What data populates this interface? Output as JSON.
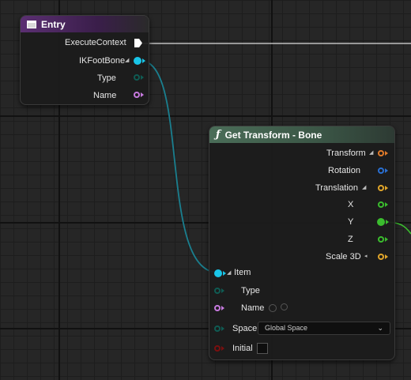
{
  "entry_node": {
    "title": "Entry",
    "pins": [
      {
        "label": "ExecuteContext",
        "kind": "exec",
        "color": "#ffffff"
      },
      {
        "label": "IKFootBone",
        "kind": "struct",
        "color": "#19c5e8"
      },
      {
        "label": "Type",
        "kind": "enum",
        "color": "#0f5b53"
      },
      {
        "label": "Name",
        "kind": "name",
        "color": "#c77adf"
      }
    ]
  },
  "get_transform_node": {
    "title": "Get Transform - Bone",
    "outputs": [
      {
        "label": "Transform",
        "color": "#e07a2a"
      },
      {
        "label": "Rotation",
        "color": "#2a6fd1"
      },
      {
        "label": "Translation",
        "color": "#e0a52a"
      },
      {
        "label": "X",
        "color": "#3bbd2e"
      },
      {
        "label": "Y",
        "color": "#3bbd2e"
      },
      {
        "label": "Z",
        "color": "#3bbd2e"
      },
      {
        "label": "Scale 3D",
        "color": "#e0a52a"
      }
    ],
    "inputs": [
      {
        "label": "Item",
        "color": "#19c5e8"
      },
      {
        "label": "Type",
        "color": "#0f5b53"
      },
      {
        "label": "Name",
        "color": "#c77adf"
      },
      {
        "label": "Space",
        "color": "#0f5b53"
      },
      {
        "label": "Initial",
        "color": "#7a0f0f"
      }
    ],
    "space_value": "Global Space",
    "initial_checked": false
  }
}
